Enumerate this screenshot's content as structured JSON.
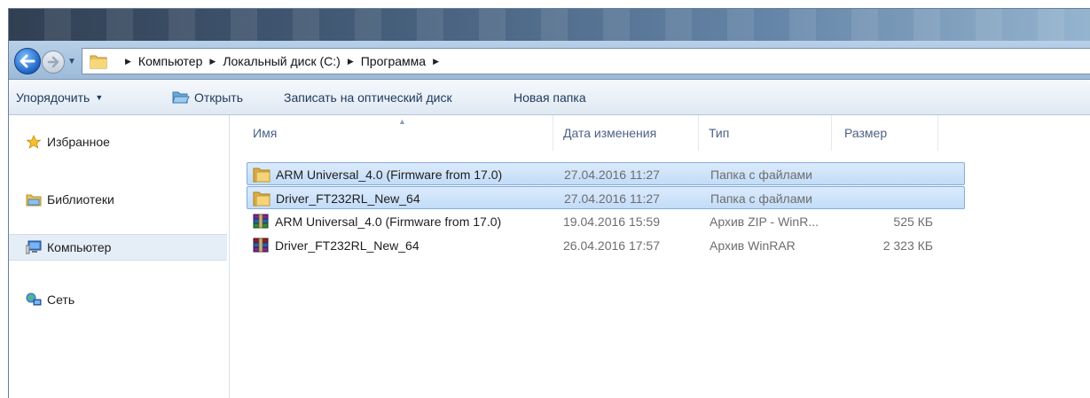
{
  "window": {
    "title_blurred": true
  },
  "navigation": {
    "breadcrumbs": [
      "Компьютер",
      "Локальный диск (C:)",
      "Программа"
    ]
  },
  "toolbar": {
    "organize": "Упорядочить",
    "open": "Открыть",
    "burn": "Записать на оптический диск",
    "new_folder": "Новая папка"
  },
  "nav_pane": {
    "items": [
      {
        "label": "Избранное",
        "icon": "star-icon"
      },
      {
        "label": "Библиотеки",
        "icon": "libraries-icon"
      },
      {
        "label": "Компьютер",
        "icon": "computer-icon",
        "selected": true
      },
      {
        "label": "Сеть",
        "icon": "network-icon"
      }
    ]
  },
  "columns": {
    "name": "Имя",
    "date": "Дата изменения",
    "type": "Тип",
    "size": "Размер"
  },
  "files": [
    {
      "name": "ARM Universal_4.0  (Firmware from 17.0)",
      "date": "27.04.2016 11:27",
      "type": "Папка с файлами",
      "size": "",
      "icon": "folder-icon",
      "selected": true
    },
    {
      "name": "Driver_FT232RL_New_64",
      "date": "27.04.2016 11:27",
      "type": "Папка с файлами",
      "size": "",
      "icon": "folder-icon",
      "selected": true
    },
    {
      "name": "ARM Universal_4.0  (Firmware from 17.0)",
      "date": "19.04.2016 15:59",
      "type": "Архив ZIP - WinR...",
      "size": "525 КБ",
      "icon": "winrar-archive-icon",
      "selected": false
    },
    {
      "name": "Driver_FT232RL_New_64",
      "date": "26.04.2016 17:57",
      "type": "Архив WinRAR",
      "size": "2 323 КБ",
      "icon": "winrar-archive-icon",
      "selected": false
    }
  ],
  "colors": {
    "selection_fill": "#cfe3fa",
    "selection_border": "#84acdd",
    "toolbar_text": "#1e395b"
  }
}
